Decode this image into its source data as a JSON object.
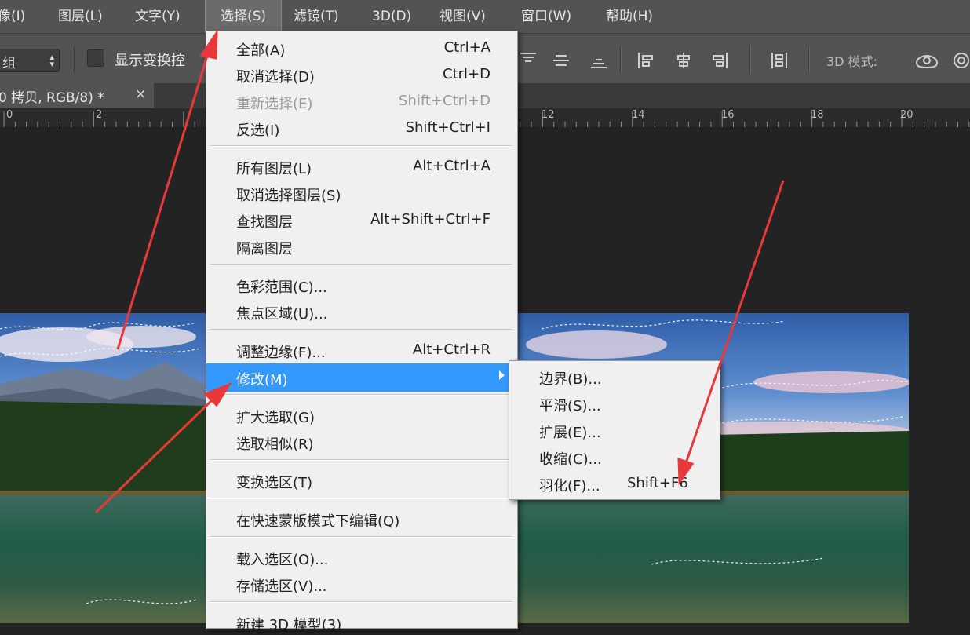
{
  "menubar": {
    "items": [
      "像(I)",
      "图层(L)",
      "文字(Y)",
      "选择(S)",
      "滤镜(T)",
      "3D(D)",
      "视图(V)",
      "窗口(W)",
      "帮助(H)"
    ],
    "active": "选择(S)"
  },
  "options": {
    "select_value": "组",
    "show_transform_label": "显示变换控",
    "mode_label": "3D 模式:"
  },
  "document_tab": {
    "title": "0 拷贝, RGB/8) *",
    "close": "×"
  },
  "ruler": {
    "labels": [
      "0",
      "2",
      "12",
      "14",
      "16",
      "18",
      "20"
    ]
  },
  "select_menu": {
    "items": [
      {
        "label": "全部(A)",
        "shortcut": "Ctrl+A"
      },
      {
        "label": "取消选择(D)",
        "shortcut": "Ctrl+D"
      },
      {
        "label": "重新选择(E)",
        "shortcut": "Shift+Ctrl+D",
        "disabled": true
      },
      {
        "label": "反选(I)",
        "shortcut": "Shift+Ctrl+I"
      },
      {
        "label": "所有图层(L)",
        "shortcut": "Alt+Ctrl+A"
      },
      {
        "label": "取消选择图层(S)",
        "shortcut": ""
      },
      {
        "label": "查找图层",
        "shortcut": "Alt+Shift+Ctrl+F"
      },
      {
        "label": "隔离图层",
        "shortcut": ""
      },
      {
        "label": "色彩范围(C)...",
        "shortcut": ""
      },
      {
        "label": "焦点区域(U)...",
        "shortcut": ""
      },
      {
        "label": "调整边缘(F)...",
        "shortcut": "Alt+Ctrl+R"
      },
      {
        "label": "修改(M)",
        "shortcut": "",
        "highlighted": true
      },
      {
        "label": "扩大选取(G)",
        "shortcut": ""
      },
      {
        "label": "选取相似(R)",
        "shortcut": ""
      },
      {
        "label": "变换选区(T)",
        "shortcut": ""
      },
      {
        "label": "在快速蒙版模式下编辑(Q)",
        "shortcut": ""
      },
      {
        "label": "载入选区(O)...",
        "shortcut": ""
      },
      {
        "label": "存储选区(V)...",
        "shortcut": ""
      },
      {
        "label": "新建 3D 模型(3)",
        "shortcut": ""
      }
    ]
  },
  "modify_submenu": {
    "items": [
      {
        "label": "边界(B)...",
        "shortcut": ""
      },
      {
        "label": "平滑(S)...",
        "shortcut": ""
      },
      {
        "label": "扩展(E)...",
        "shortcut": ""
      },
      {
        "label": "收缩(C)...",
        "shortcut": ""
      },
      {
        "label": "羽化(F)...",
        "shortcut": "Shift+F6"
      }
    ]
  },
  "colors": {
    "menu_highlight": "#3399ff",
    "annotation_arrow": "#e8383a",
    "app_chrome": "#535353"
  }
}
